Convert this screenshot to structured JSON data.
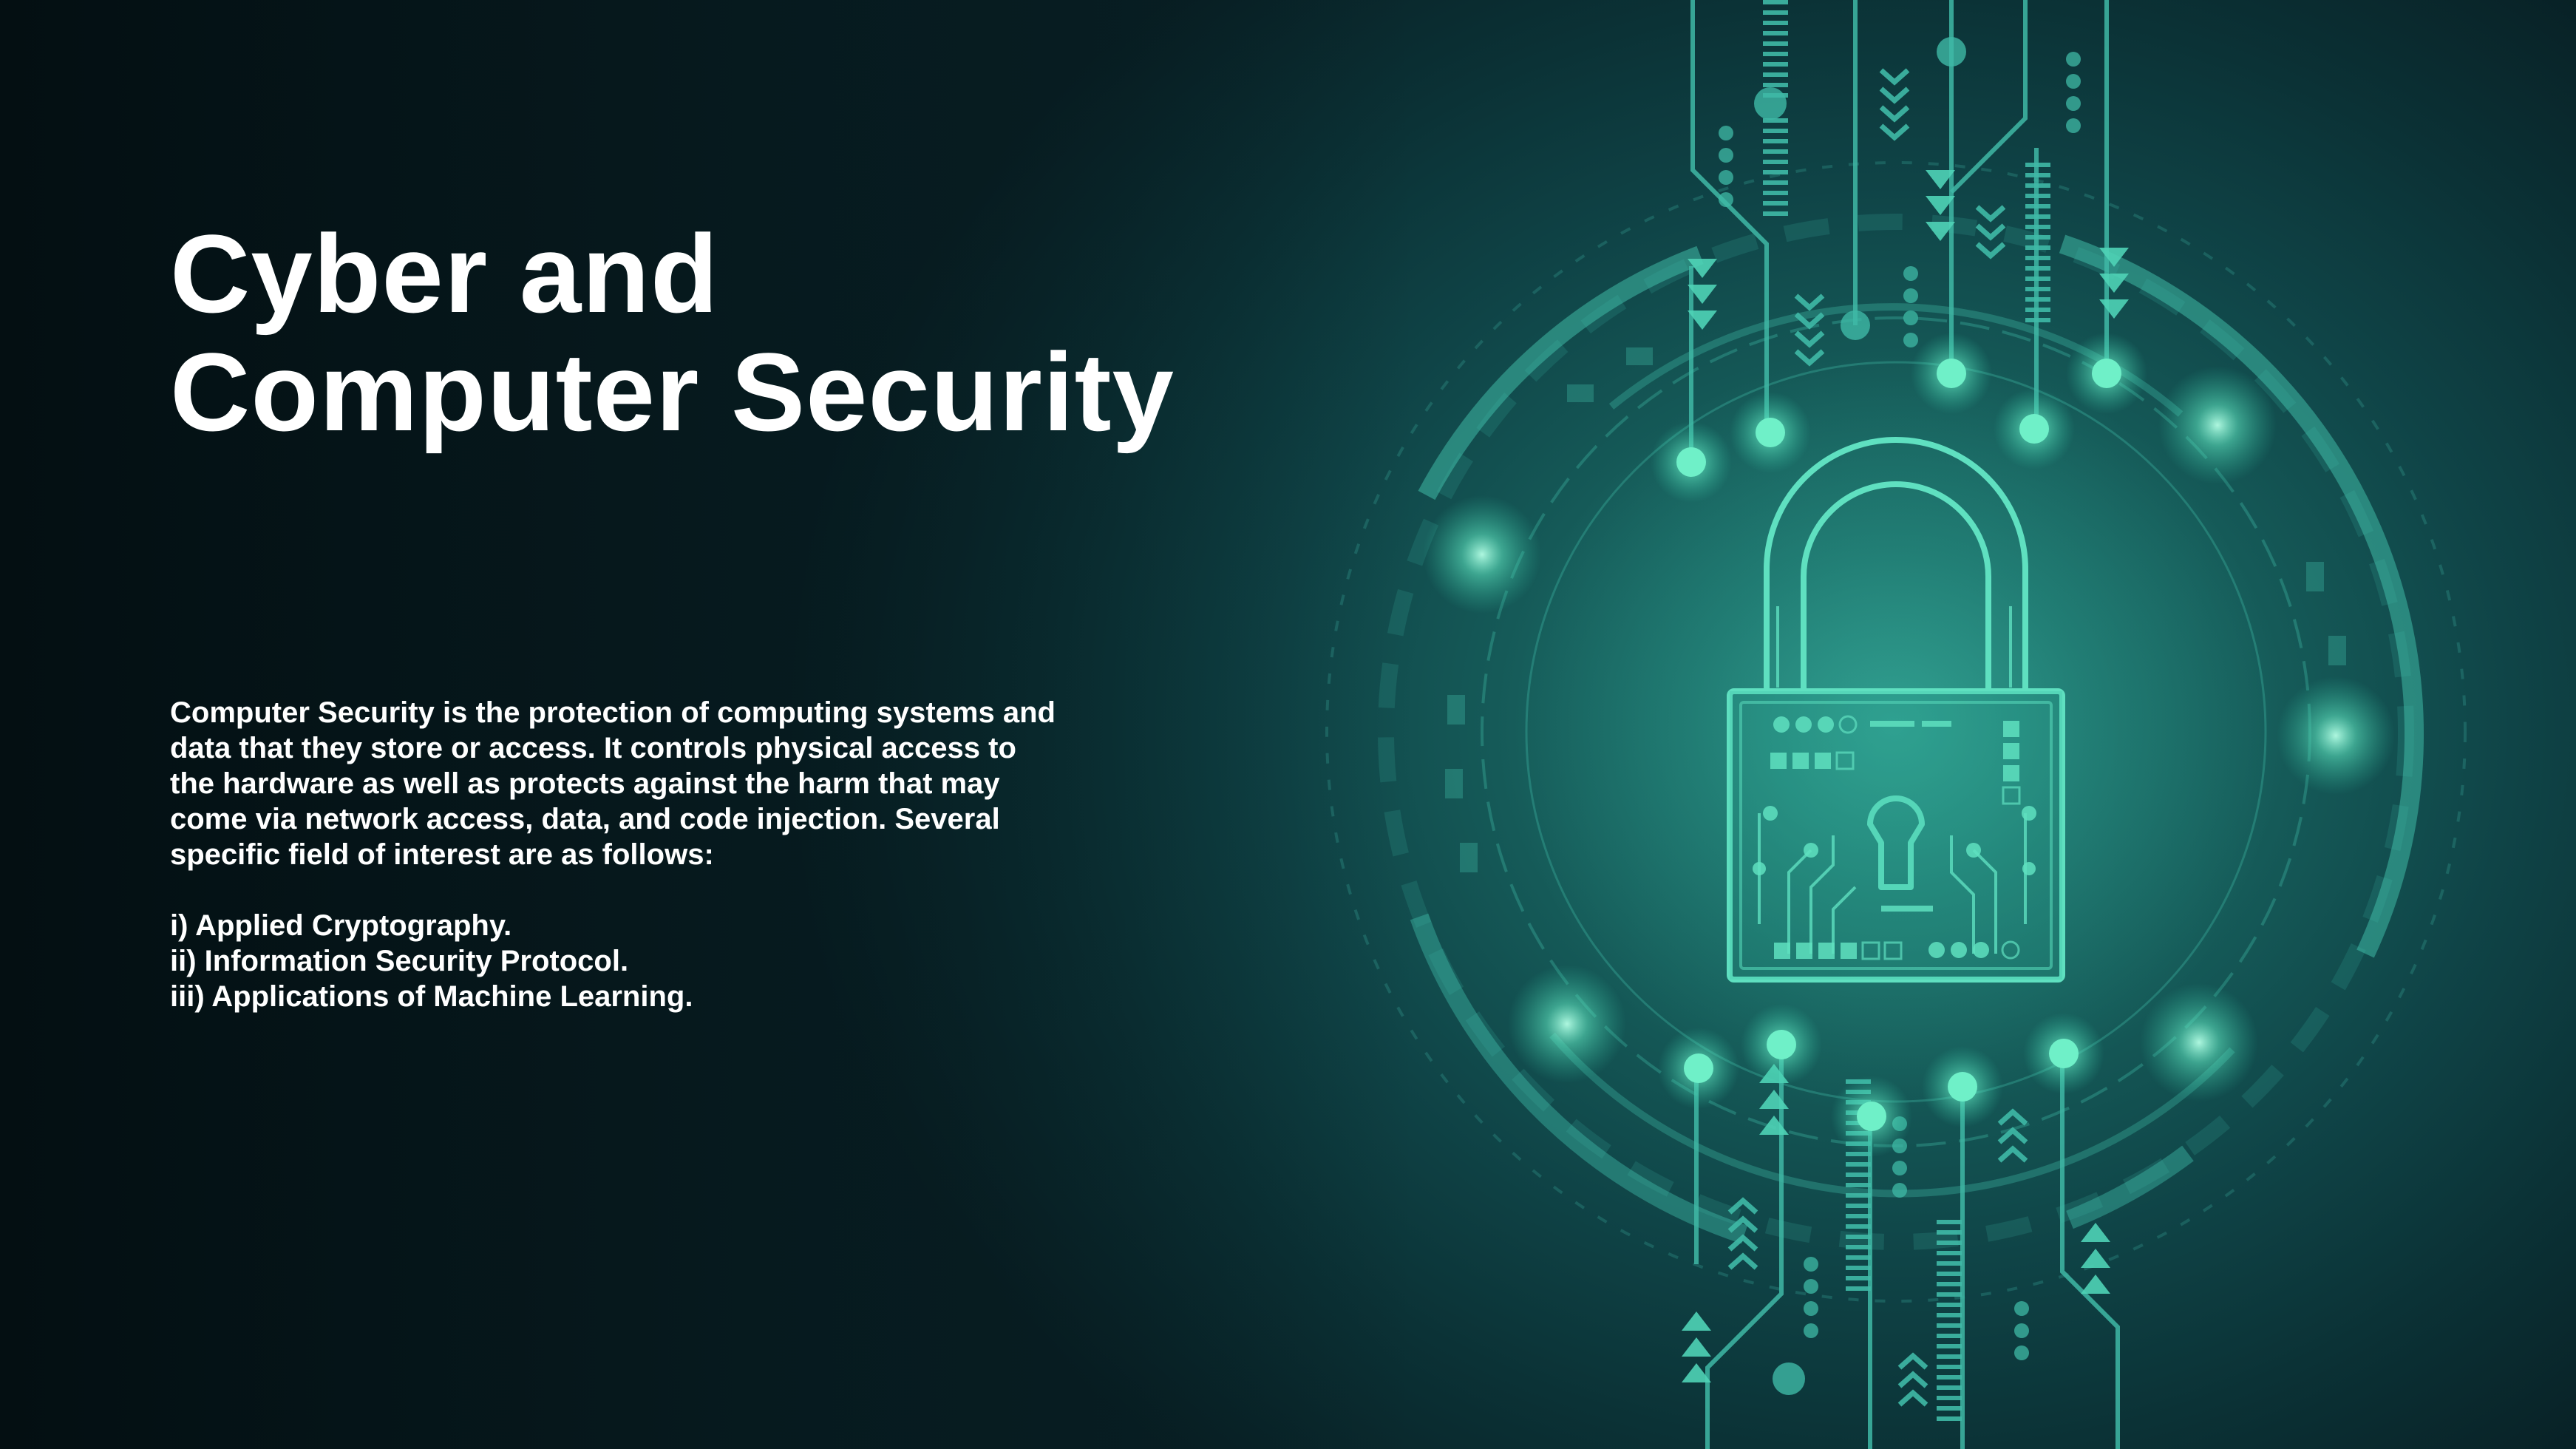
{
  "slide": {
    "title_line1": "Cyber and",
    "title_line2": "Computer Security",
    "description": "Computer Security is the protection of computing systems and data that they store or access. It controls physical access to the hardware as well as protects against the harm that may come via network access, data, and code injection. Several specific field of interest are as follows:",
    "items": [
      "i) Applied Cryptography.",
      "ii) Information Security Protocol.",
      "iii)  Applications of Machine Learning."
    ]
  },
  "artwork": {
    "icon": "padlock-circuit-icon",
    "colors": {
      "background_dark": "#061a1e",
      "teal": "#3fb9a6",
      "glow": "#6ff0c8",
      "text": "#ffffff"
    }
  }
}
